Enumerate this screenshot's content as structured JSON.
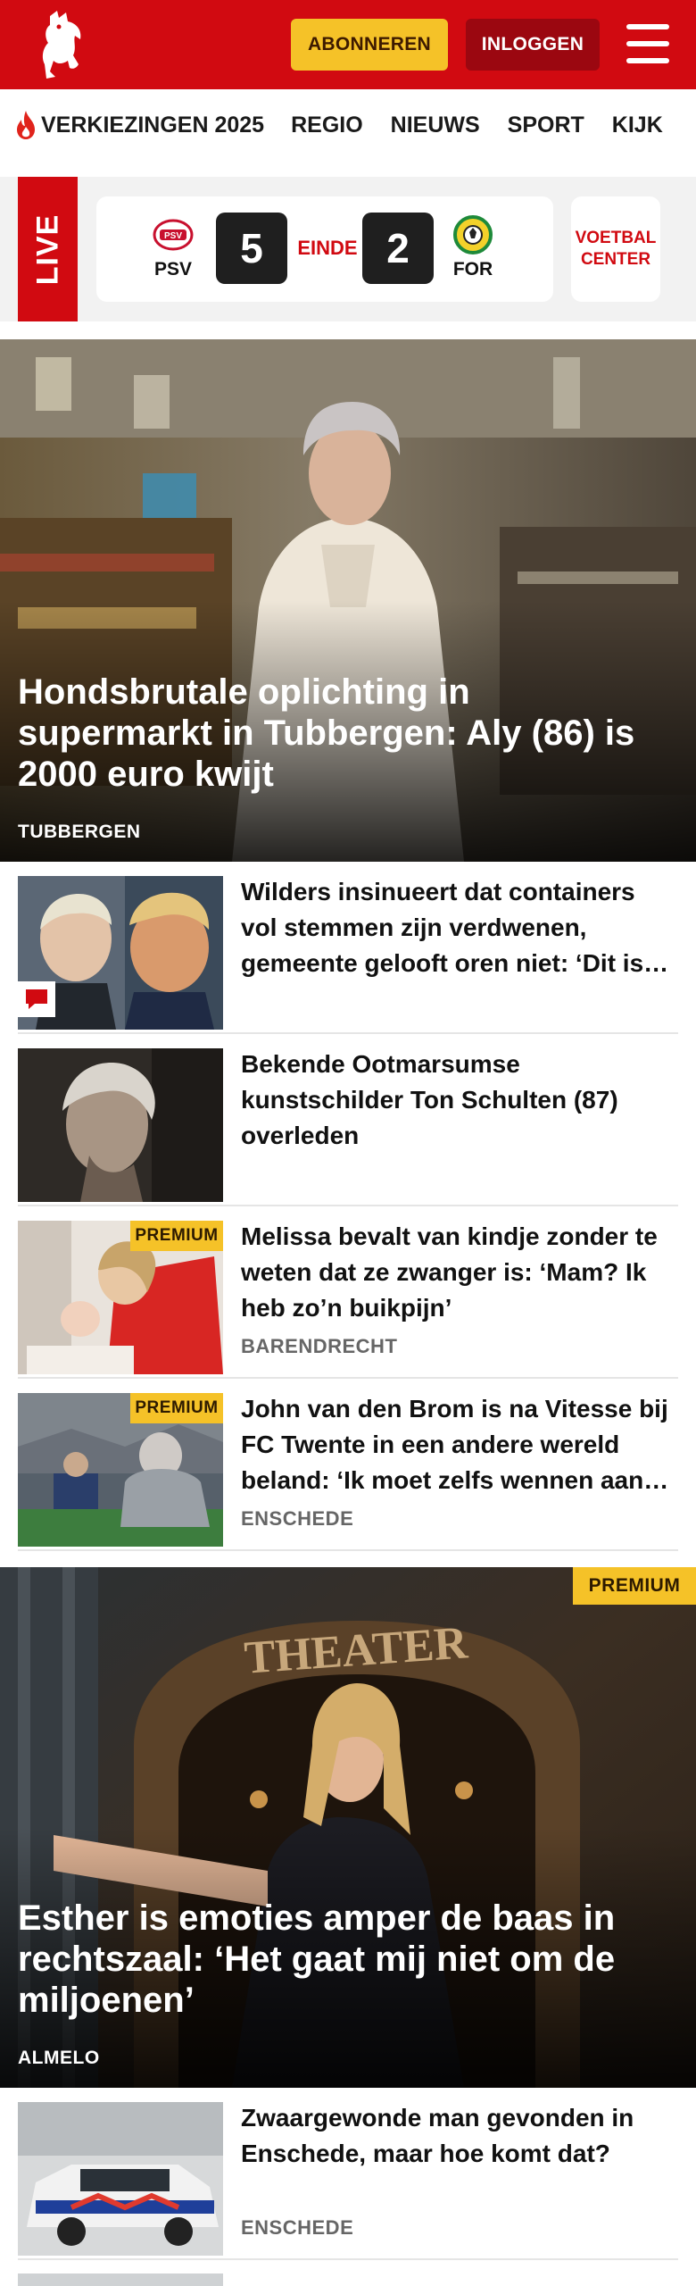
{
  "header": {
    "subscribe_label": "ABONNEREN",
    "login_label": "INLOGGEN",
    "brand_color": "#d10a11",
    "subscribe_color": "#f5c228"
  },
  "nav": {
    "items": [
      "VERKIEZINGEN 2025",
      "REGIO",
      "NIEUWS",
      "SPORT",
      "KIJK"
    ]
  },
  "live": {
    "label": "LIVE",
    "home_team": "PSV",
    "home_score": "5",
    "status": "EINDE",
    "away_score": "2",
    "away_team": "FOR",
    "center_label": "VOETBAL CENTER"
  },
  "hero1": {
    "title": "Hondsbrutale oplichting in supermarkt in Tubbergen: Aly (86) is 2000 euro kwijt",
    "location": "TUBBERGEN"
  },
  "list1": [
    {
      "title": "Wilders insinueert dat containers vol stemmen zijn verdwenen, gemeente gelooft oren niet: ‘Dit is het meest treurige wat ik ooit heb gehoord’",
      "location": "",
      "premium": "",
      "comment_icon": "comment-icon"
    },
    {
      "title": "Bekende Ootmarsumse kunstschilder Ton Schulten (87) overleden",
      "location": "",
      "premium": ""
    },
    {
      "title": "Melissa bevalt van kindje zonder te weten dat ze zwanger is: ‘Mam? Ik heb zo’n buikpijn’",
      "location": "BARENDRECHT",
      "premium": "PREMIUM"
    },
    {
      "title": "John van den Brom is na Vitesse bij FC Twente in een andere wereld beland: ‘Ik moet zelfs wennen aan de rust’",
      "location": "ENSCHEDE",
      "premium": "PREMIUM"
    }
  ],
  "hero2": {
    "title": "Esther is emoties amper de baas in rechtszaal: ‘Het gaat mij niet om de miljoenen’",
    "location": "ALMELO",
    "premium": "PREMIUM"
  },
  "list2": [
    {
      "title": "Zwaargewonde man gevonden in Enschede, maar hoe komt dat?",
      "location": "ENSCHEDE",
      "premium": ""
    }
  ]
}
